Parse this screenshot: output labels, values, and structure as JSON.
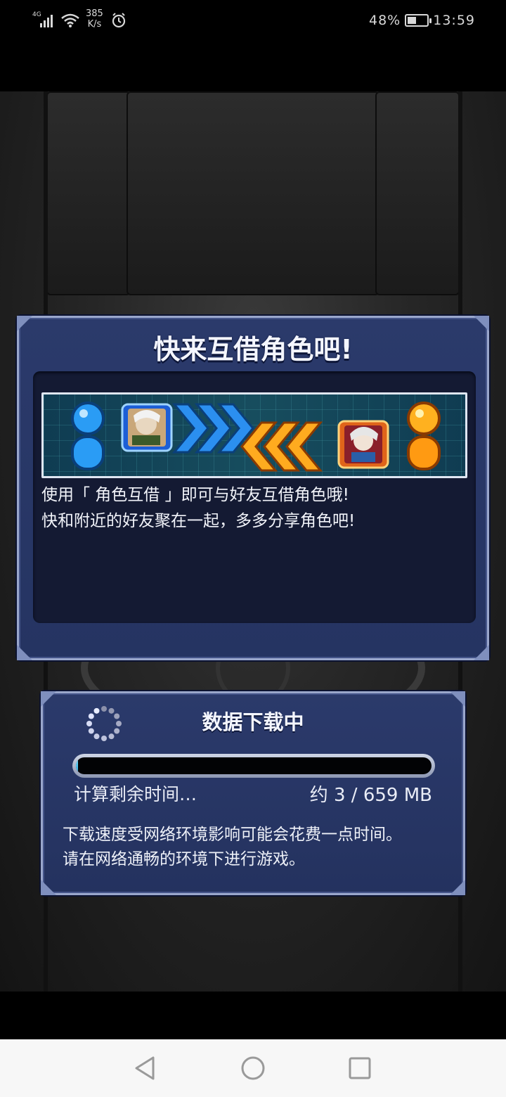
{
  "status_bar": {
    "network": "4G",
    "speed_value": "385",
    "speed_unit": "K/s",
    "battery_percent": "48%",
    "battery_level": 0.48,
    "time": "13:59",
    "icons": [
      "signal-icon",
      "wifi-icon",
      "alarm-icon",
      "battery-icon"
    ]
  },
  "share_dialog": {
    "title": "快来互借角色吧!",
    "line1": "使用「 角色互借 」即可与好友互借角色哦!",
    "line2": "快和附近的好友聚在一起，多多分享角色吧!"
  },
  "download": {
    "title": "数据下载中",
    "status": "计算剩余时间…",
    "size": "约 3 / 659 MB",
    "progress": 0.005,
    "note_line1": "下载速度受网络环境影响可能会花费一点时间。",
    "note_line2": "请在网络通畅的环境下进行游戏。"
  },
  "nav": {
    "icons": [
      "back-icon",
      "home-icon",
      "recents-icon"
    ]
  },
  "colors": {
    "dialog_bg": "#2b3a6b",
    "dialog_border": "#9aa7cc",
    "player_blue": "#1e8ef0",
    "player_orange": "#ffa21a",
    "nav_bg": "#f7f7f7"
  }
}
